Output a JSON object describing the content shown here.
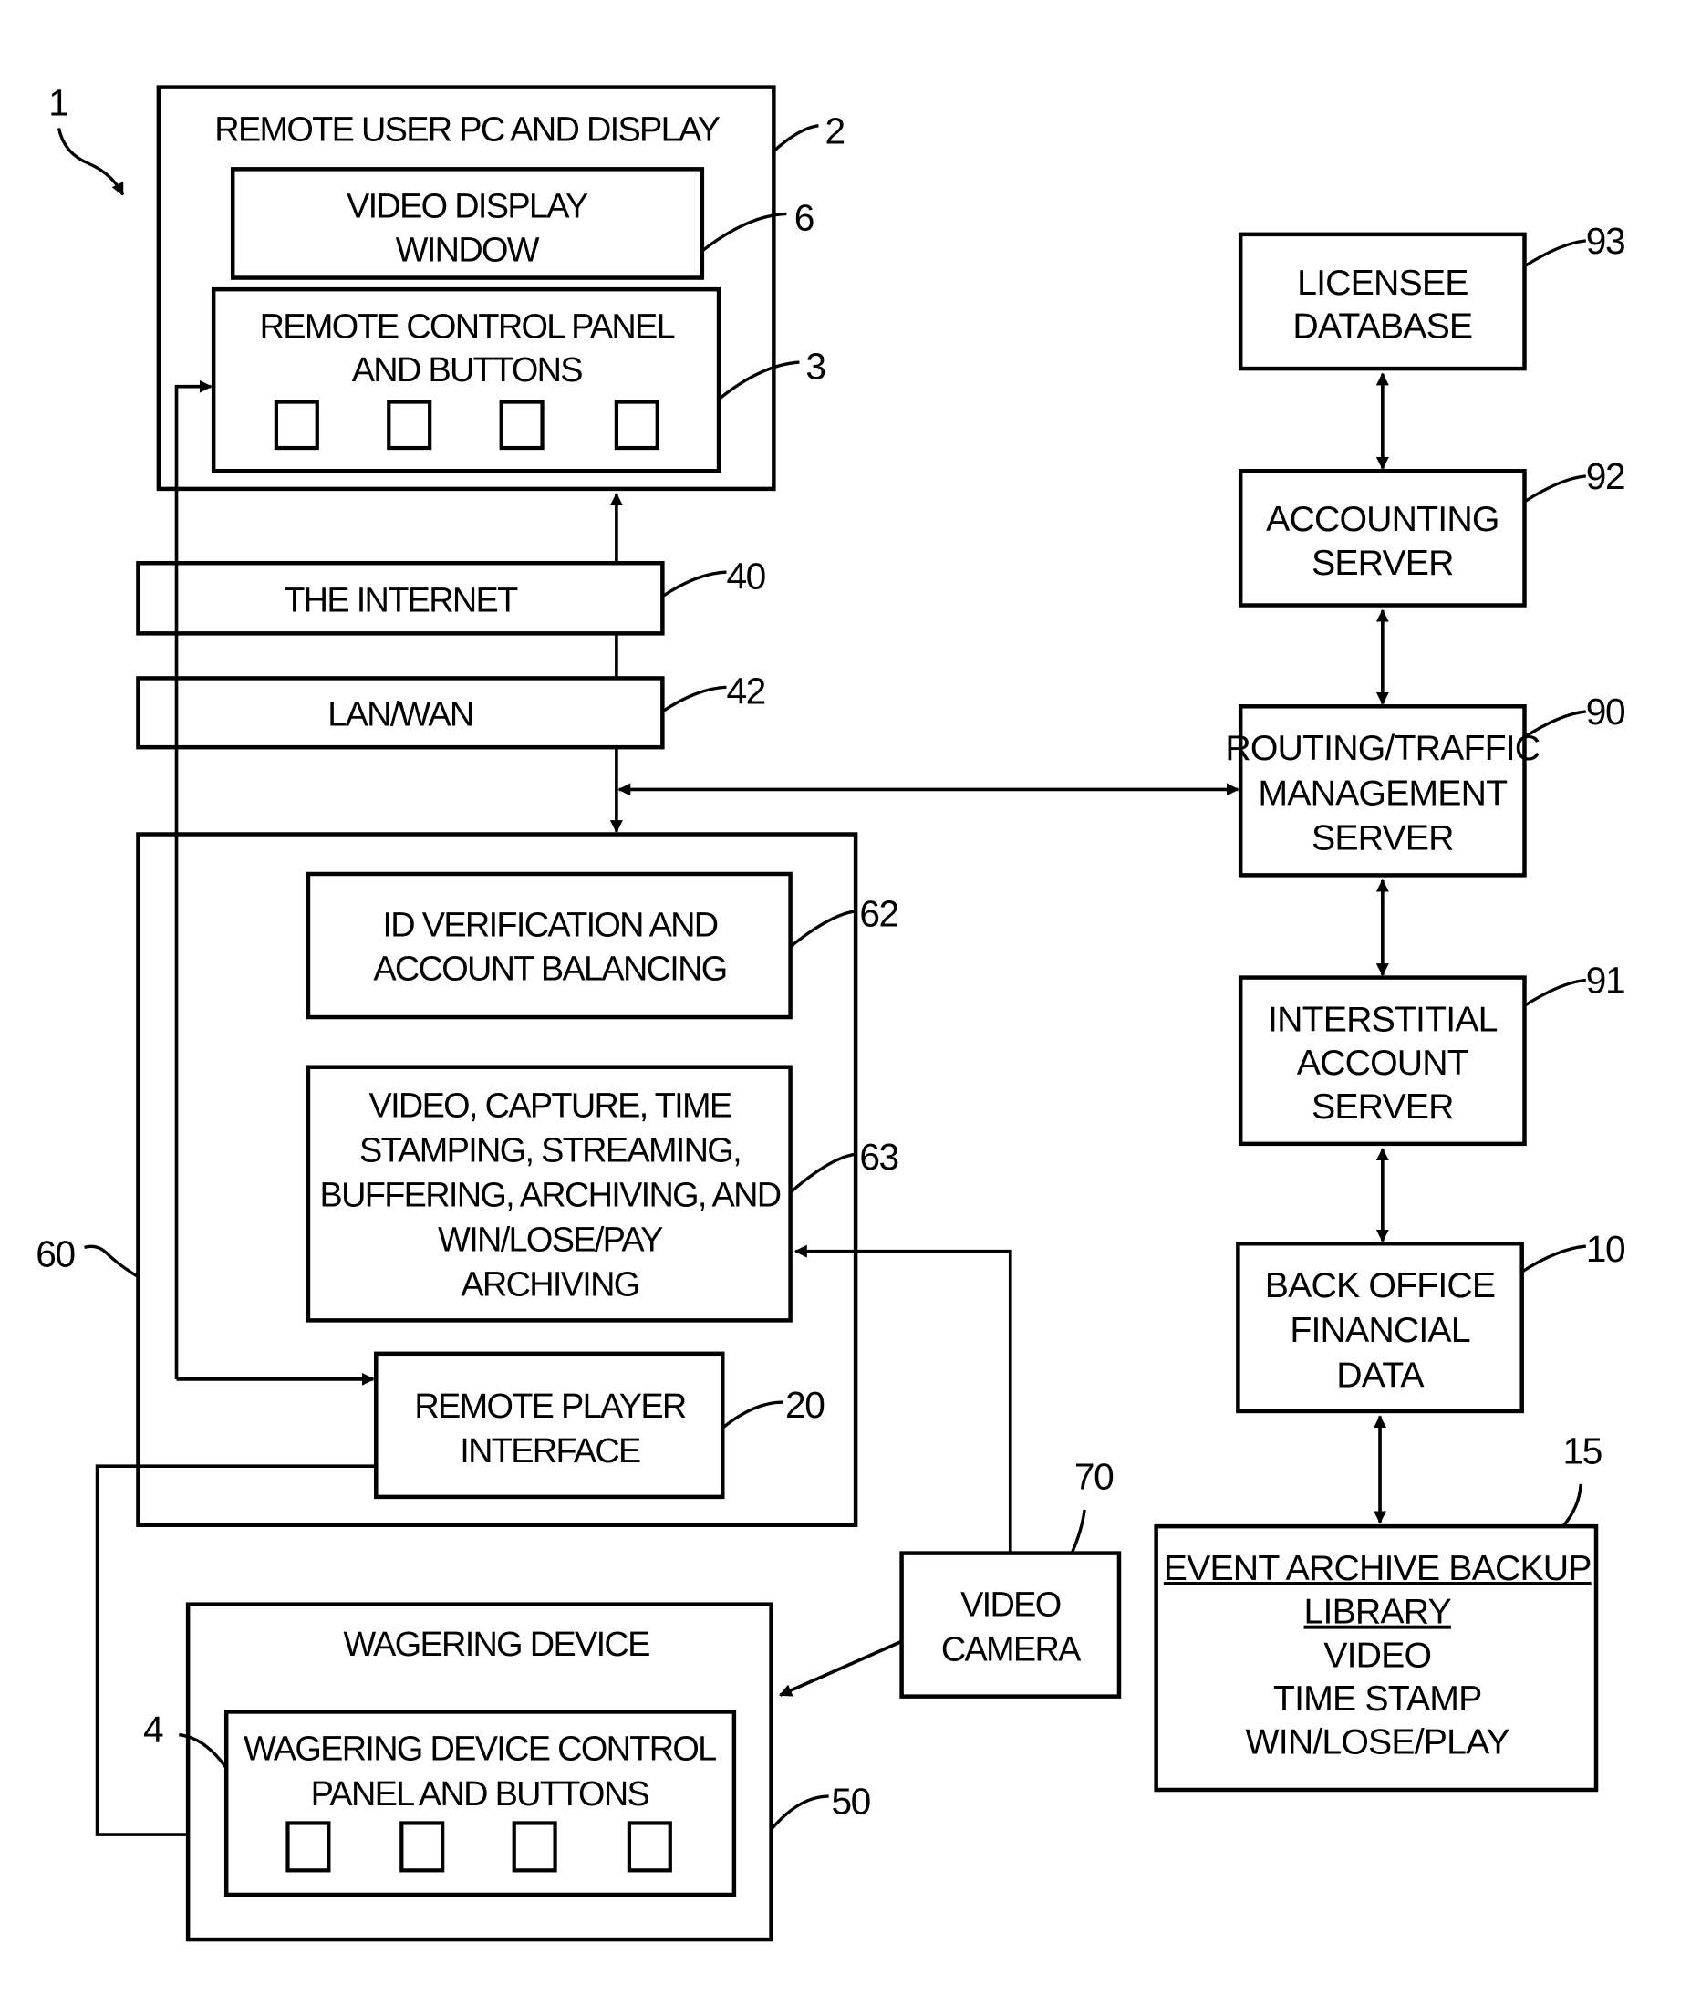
{
  "figure": {
    "figure_ref": "1",
    "blocks": {
      "remote_user_pc": {
        "ref": "2",
        "lines": [
          "REMOTE USER PC AND DISPLAY"
        ]
      },
      "video_display_window": {
        "ref": "6",
        "lines": [
          "VIDEO DISPLAY",
          "WINDOW"
        ]
      },
      "remote_control_panel": {
        "ref": "3",
        "lines": [
          "REMOTE CONTROL PANEL",
          "AND BUTTONS"
        ],
        "button_count": 4
      },
      "internet": {
        "ref": "40",
        "lines": [
          "THE INTERNET"
        ]
      },
      "lan_wan": {
        "ref": "42",
        "lines": [
          "LAN/WAN"
        ]
      },
      "server_group": {
        "ref": "60"
      },
      "id_verification": {
        "ref": "62",
        "lines": [
          "ID VERIFICATION AND",
          "ACCOUNT BALANCING"
        ]
      },
      "video_capture": {
        "ref": "63",
        "lines": [
          "VIDEO, CAPTURE, TIME",
          "STAMPING, STREAMING,",
          "BUFFERING, ARCHIVING, AND",
          "WIN/LOSE/PAY",
          "ARCHIVING"
        ]
      },
      "remote_player_interface": {
        "ref": "20",
        "lines": [
          "REMOTE PLAYER",
          "INTERFACE"
        ]
      },
      "video_camera": {
        "ref": "70",
        "lines": [
          "VIDEO",
          "CAMERA"
        ]
      },
      "wagering_device": {
        "ref": "50",
        "lines": [
          "WAGERING DEVICE"
        ]
      },
      "wagering_control_panel": {
        "ref": "4",
        "lines": [
          "WAGERING DEVICE CONTROL",
          "PANEL AND BUTTONS"
        ],
        "button_count": 4
      },
      "licensee_database": {
        "ref": "93",
        "lines": [
          "LICENSEE",
          "DATABASE"
        ]
      },
      "accounting_server": {
        "ref": "92",
        "lines": [
          "ACCOUNTING",
          "SERVER"
        ]
      },
      "routing_server": {
        "ref": "90",
        "lines": [
          "ROUTING/TRAFFIC",
          "MANAGEMENT",
          "SERVER"
        ]
      },
      "interstitial_server": {
        "ref": "91",
        "lines": [
          "INTERSTITIAL",
          "ACCOUNT",
          "SERVER"
        ]
      },
      "back_office": {
        "ref": "10",
        "lines": [
          "BACK OFFICE",
          "FINANCIAL",
          "DATA"
        ]
      },
      "event_archive": {
        "ref": "15",
        "underlined_lines": [
          "EVENT ARCHIVE BACKUP",
          "LIBRARY"
        ],
        "lines": [
          "VIDEO",
          "TIME STAMP",
          "WIN/LOSE/PLAY"
        ]
      }
    }
  }
}
